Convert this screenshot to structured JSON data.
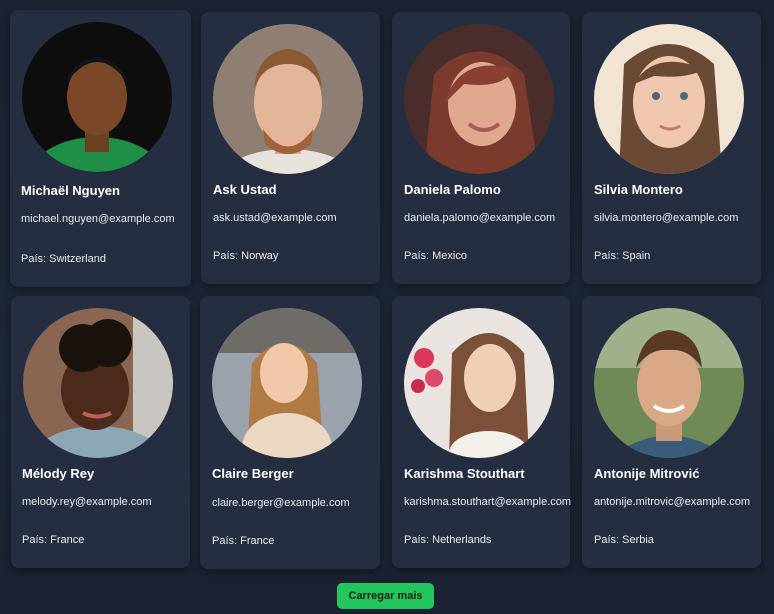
{
  "users": [
    {
      "name": "Michaël Nguyen",
      "email": "michael.nguyen@example.com",
      "country": "País: Switzerland"
    },
    {
      "name": "Ask Ustad",
      "email": "ask.ustad@example.com",
      "country": "País: Norway"
    },
    {
      "name": "Daniela Palomo",
      "email": "daniela.palomo@example.com",
      "country": "País: Mexico"
    },
    {
      "name": "Silvia Montero",
      "email": "silvia.montero@example.com",
      "country": "País: Spain"
    },
    {
      "name": "Mélody Rey",
      "email": "melody.rey@example.com",
      "country": "País: France"
    },
    {
      "name": "Claire Berger",
      "email": "claire.berger@example.com",
      "country": "País: France"
    },
    {
      "name": "Karishma Stouthart",
      "email": "karishma.stouthart@example.com",
      "country": "País: Netherlands"
    },
    {
      "name": "Antonije Mitrović",
      "email": "antonije.mitrovic@example.com",
      "country": "País: Serbia"
    }
  ],
  "load_more_label": "Carregar mais",
  "colors": {
    "background": "#1b2334",
    "card": "#252e40",
    "button": "#22c55e"
  }
}
